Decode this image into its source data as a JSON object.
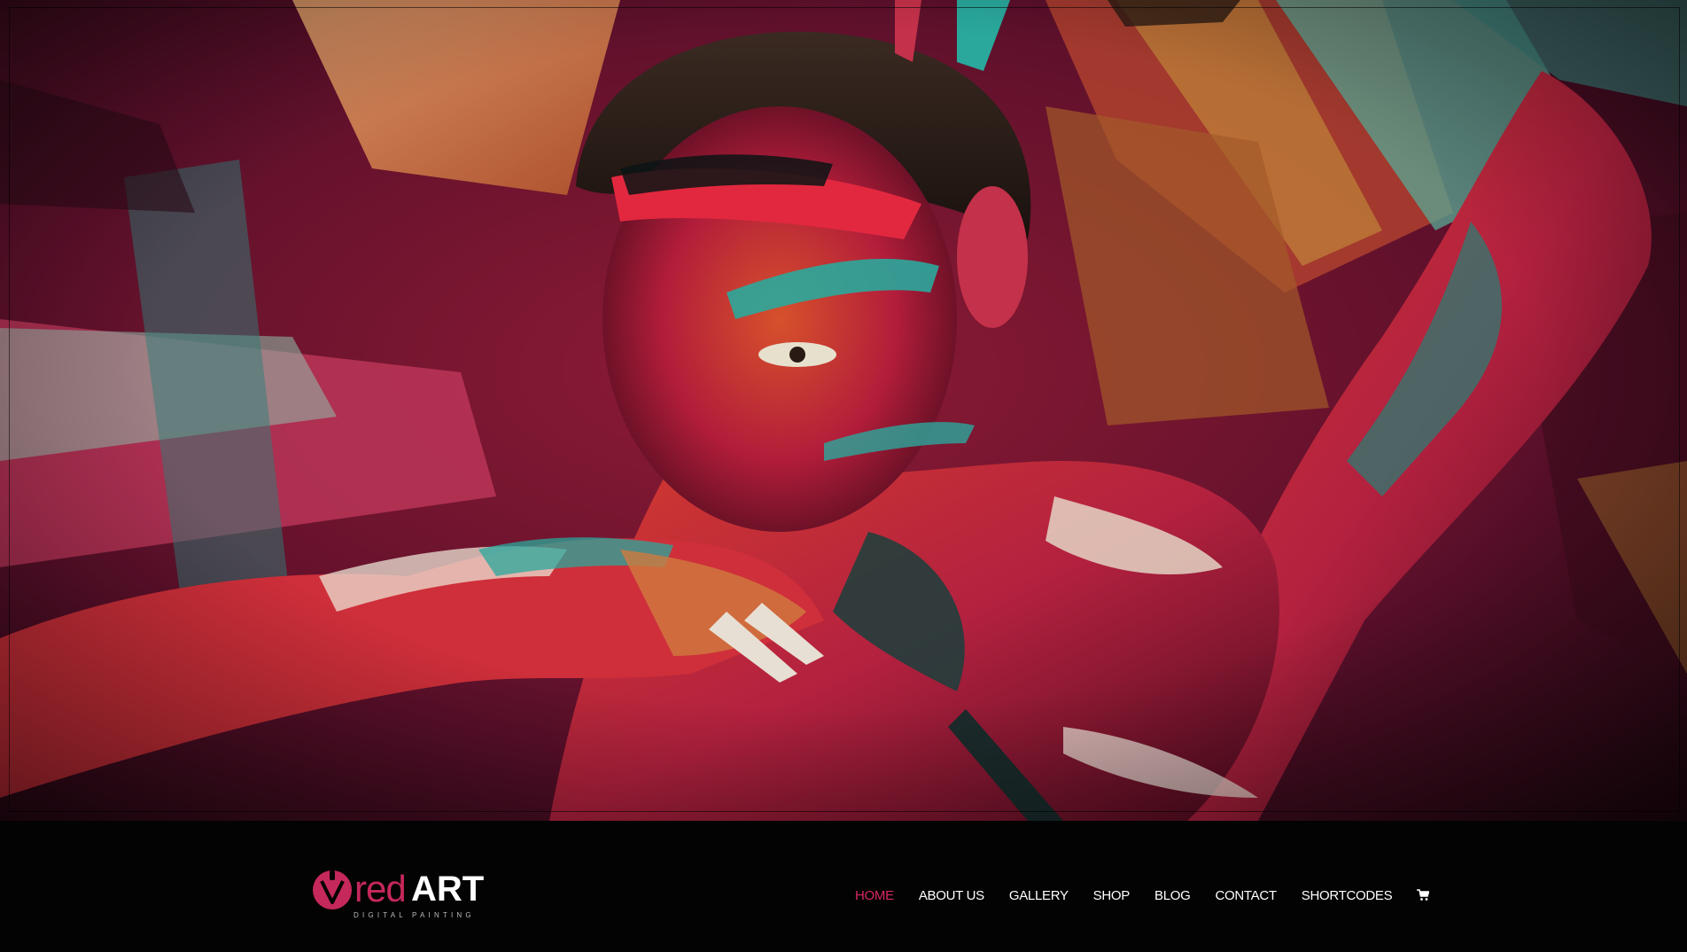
{
  "hero": {
    "image": "body-paint-portrait"
  },
  "logo": {
    "icon": "brush-v-logo-icon",
    "brand_light": "red",
    "brand_bold": "ART",
    "tagline": "DIGITAL PAINTING",
    "accent_color": "#c5285a"
  },
  "nav": {
    "items": [
      {
        "label": "HOME",
        "active": true
      },
      {
        "label": "ABOUT US",
        "active": false
      },
      {
        "label": "GALLERY",
        "active": false
      },
      {
        "label": "SHOP",
        "active": false
      },
      {
        "label": "BLOG",
        "active": false
      },
      {
        "label": "CONTACT",
        "active": false
      },
      {
        "label": "SHORTCODES",
        "active": false
      }
    ],
    "cart_icon": "cart-icon",
    "active_color": "#d6285f"
  }
}
